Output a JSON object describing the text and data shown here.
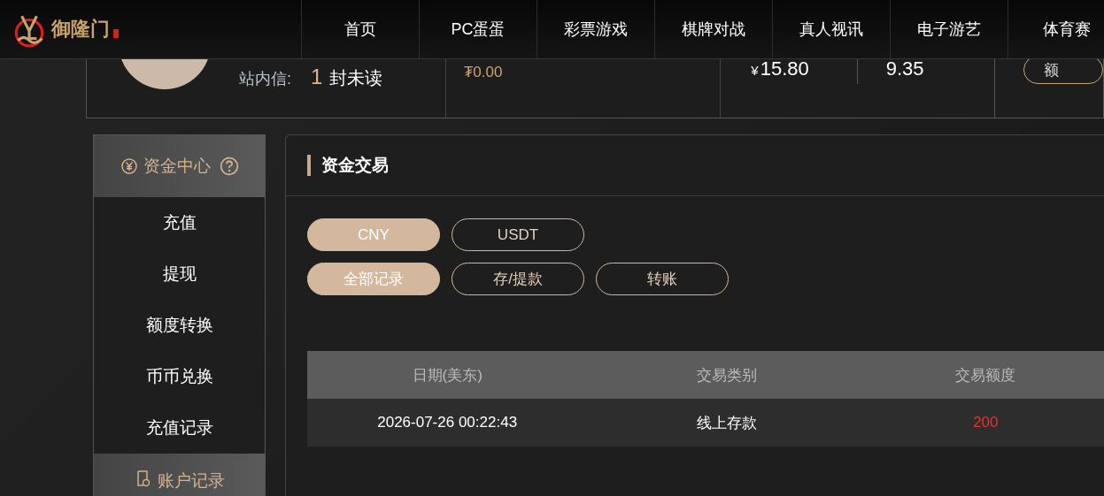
{
  "logo": {
    "name": "御隆门"
  },
  "nav": [
    {
      "label": "首页"
    },
    {
      "label": "PC蛋蛋"
    },
    {
      "label": "彩票游戏"
    },
    {
      "label": "棋牌对战"
    },
    {
      "label": "真人视讯"
    },
    {
      "label": "电子游艺"
    },
    {
      "label": "体育赛"
    }
  ],
  "account_card": {
    "message_label": "站内信:",
    "unread_count": "1",
    "unread_suffix": "封未读",
    "usdt_balance": "₮0.00",
    "balance_currency": "¥",
    "balance": "15.80",
    "second_value": "9.35",
    "button_label": "额"
  },
  "sidebar": [
    {
      "title": "资金中心",
      "kind": "funds",
      "help": true,
      "items": [
        "充值",
        "提现",
        "额度转换",
        "币币兑换",
        "充值记录"
      ]
    },
    {
      "title": "账户记录",
      "kind": "records",
      "help": false
    }
  ],
  "panel": {
    "title": "资金交易",
    "currency_tabs": [
      {
        "label": "CNY",
        "selected": true
      },
      {
        "label": "USDT",
        "selected": false
      }
    ],
    "record_tabs": [
      {
        "label": "全部记录",
        "selected": true
      },
      {
        "label": "存/提款",
        "selected": false
      },
      {
        "label": "转账",
        "selected": false
      }
    ],
    "table": {
      "columns": [
        "日期(美东)",
        "交易类别",
        "交易额度"
      ],
      "rows": [
        {
          "date": "2026-07-26 00:22:43",
          "type": "线上存款",
          "amount": "200"
        }
      ]
    }
  }
}
